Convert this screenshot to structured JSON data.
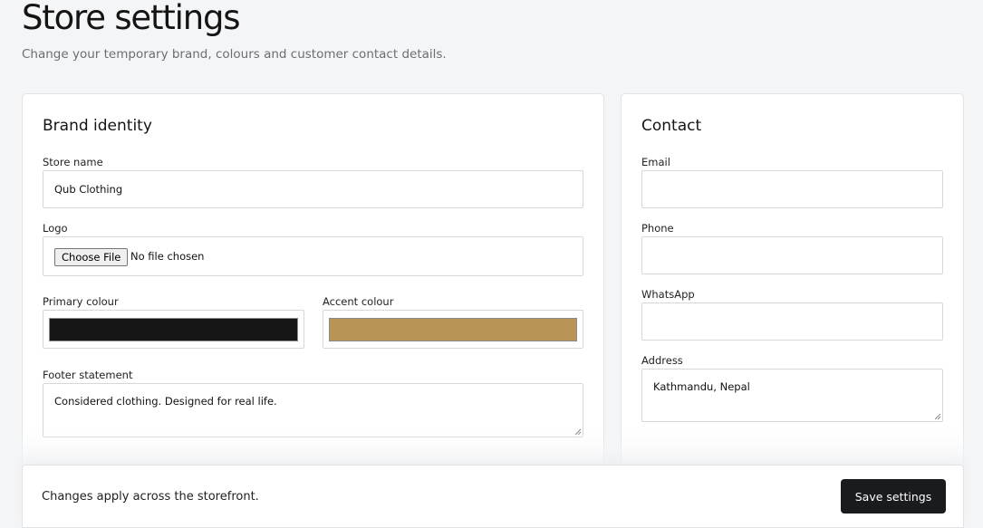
{
  "header": {
    "title": "Store settings",
    "subtitle": "Change your temporary brand, colours and customer contact details."
  },
  "brand": {
    "title": "Brand identity",
    "store_name": {
      "label": "Store name",
      "value": "Qub Clothing"
    },
    "logo": {
      "label": "Logo",
      "button": "Choose File",
      "status": "No file chosen"
    },
    "primary_colour": {
      "label": "Primary colour",
      "value": "#161616"
    },
    "accent_colour": {
      "label": "Accent colour",
      "value": "#b89457"
    },
    "footer_statement": {
      "label": "Footer statement",
      "value": "Considered clothing. Designed for real life."
    }
  },
  "contact": {
    "title": "Contact",
    "email": {
      "label": "Email",
      "value": ""
    },
    "phone": {
      "label": "Phone",
      "value": ""
    },
    "whatsapp": {
      "label": "WhatsApp",
      "value": ""
    },
    "address": {
      "label": "Address",
      "value": "Kathmandu, Nepal"
    }
  },
  "footer": {
    "note": "Changes apply across the storefront.",
    "save_label": "Save settings"
  }
}
